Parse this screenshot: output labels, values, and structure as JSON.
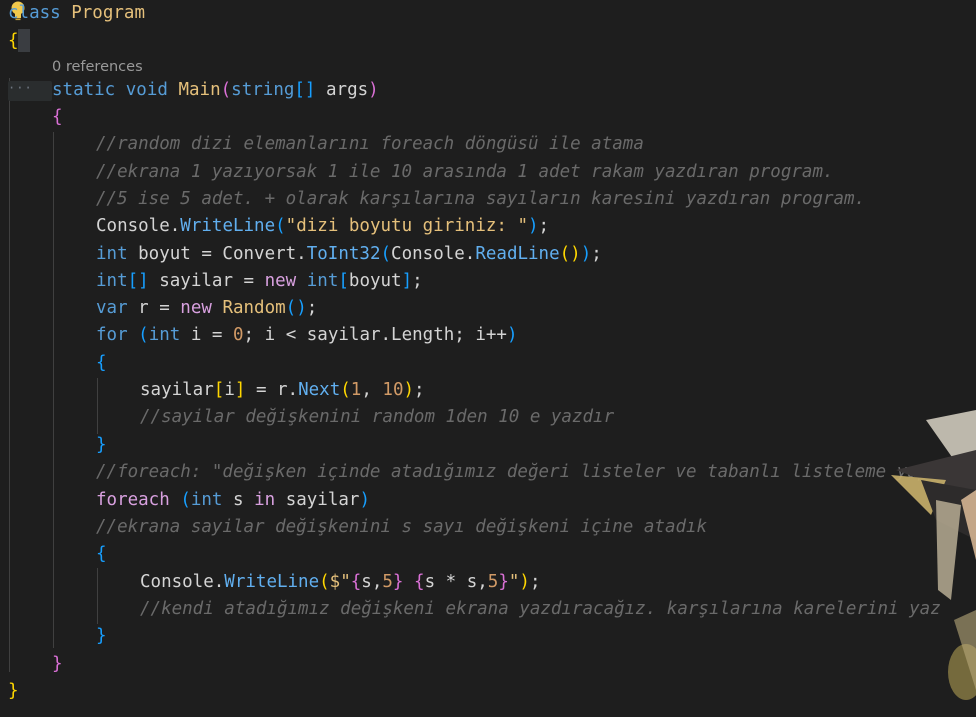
{
  "editor": {
    "codelens": "0 references",
    "fold_marker": "···",
    "lines": {
      "l1": {
        "kw": "class",
        "name": "Program"
      },
      "l2": {
        "brace": "{"
      },
      "l3": {
        "kw1": "static",
        "kw2": "void",
        "method": "Main",
        "open": "(",
        "type": "string",
        "arr": "[]",
        "param": " args",
        "close": ")"
      },
      "l4": {
        "brace": "{"
      },
      "l5": "//random dizi elemanlarını foreach döngüsü ile atama",
      "l6": "//ekrana 1 yazıyorsak 1 ile 10 arasında 1 adet rakam yazdıran program.",
      "l7": "//5 ise 5 adet. + olarak karşılarına sayıların karesini yazdıran program.",
      "l8": {
        "obj": "Console.",
        "method": "WriteLine",
        "open": "(",
        "str": "\"dizi boyutu giriniz: \"",
        "close": ")",
        "end": ";"
      },
      "l9": {
        "kw": "int",
        "t1": " boyut = Convert.",
        "method": "ToInt32",
        "open": "(",
        "obj": "Console.",
        "method2": "ReadLine",
        "inner": "()",
        "close": ")",
        "end": ";"
      },
      "l10": {
        "kw": "int",
        "arr": "[]",
        "t1": " sayilar = ",
        "kw2": "new",
        "sp": " ",
        "kw3": "int",
        "open": "[",
        "t2": "boyut",
        "close": "]",
        "end": ";"
      },
      "l11": {
        "kw": "var",
        "t1": " r = ",
        "kw2": "new",
        "sp": " ",
        "cls": "Random",
        "paren": "()",
        "end": ";"
      },
      "l12": {
        "kw": "for",
        "sp": " ",
        "open": "(",
        "kw2": "int",
        "t1": " i = ",
        "num": "0",
        "t2": "; i < sayilar.Length; i++",
        "close": ")"
      },
      "l13": {
        "brace": "{"
      },
      "l14": {
        "t1": "sayilar",
        "open": "[",
        "idx": "i",
        "close": "]",
        "t2": " = r.",
        "method": "Next",
        "popen": "(",
        "n1": "1",
        "comma": ", ",
        "n2": "10",
        "pclose": ")",
        "end": ";"
      },
      "l15": "//sayilar değişkenini random 1den 10 e yazdır",
      "l16": {
        "brace": "}"
      },
      "l17": "//foreach: \"değişken içinde atadığımız değeri listeler ve tabanlı listeleme yapa",
      "l18": {
        "kw": "foreach",
        "sp": " ",
        "open": "(",
        "kw2": "int",
        "t1": " s ",
        "kw3": "in",
        "t2": " sayilar",
        "close": ")"
      },
      "l19": "//ekrana sayilar değişkenini s sayı değişkeni içine atadık",
      "l20": {
        "brace": "{"
      },
      "l21": {
        "obj": "Console.",
        "method": "WriteLine",
        "open": "(",
        "str1": "$\"",
        "b1": "{",
        "t1": "s,",
        "n1": "5",
        "b2": "}",
        "sp": " ",
        "b3": "{",
        "t2": "s * s,",
        "n2": "5",
        "b4": "}",
        "str2": "\"",
        "close": ")",
        "end": ";"
      },
      "l22": "//kendi atadığımız değişkeni ekrana yazdıracağız. karşılarına karelerini yaz",
      "l23": {
        "brace": "}"
      },
      "l24": {
        "brace": "}"
      },
      "l25": {
        "brace": "}"
      }
    }
  },
  "colors": {
    "background": "#1e1e1e",
    "keyword": "#569cd6",
    "class_name": "#e5c07b",
    "method": "#61afef",
    "string": "#ce9178",
    "number": "#d19a66",
    "comment": "#6a6a6a",
    "bracket_gold": "#ffd700",
    "bracket_purple": "#da70d6",
    "bracket_blue": "#179fff"
  },
  "icons": {
    "lightbulb": "lightbulb-icon",
    "mascot": "anime-character-decoration"
  }
}
